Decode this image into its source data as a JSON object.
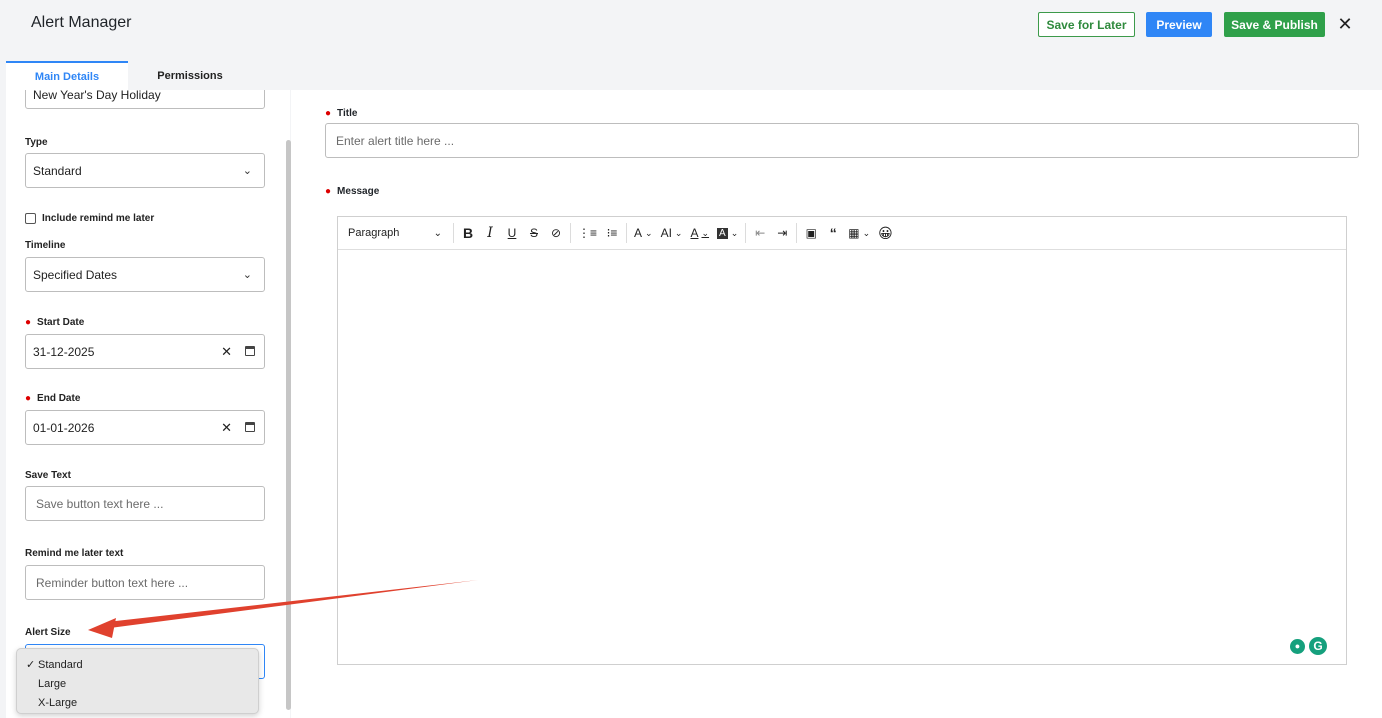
{
  "header": {
    "title": "Alert Manager",
    "save_later": "Save for Later",
    "preview": "Preview",
    "publish": "Save & Publish",
    "close": "✕"
  },
  "tabs": [
    "Main Details",
    "Permissions"
  ],
  "left": {
    "name_value": "New Year's Day Holiday",
    "type_label": "Type",
    "type_value": "Standard",
    "remind_checkbox_label": "Include remind me later",
    "timeline_label": "Timeline",
    "timeline_value": "Specified Dates",
    "start_label": "Start Date",
    "start_value": "31-12-2025",
    "end_label": "End Date",
    "end_value": "01-01-2026",
    "save_text_label": "Save Text",
    "save_text_placeholder": "Save button text here ...",
    "remind_text_label": "Remind me later text",
    "remind_text_placeholder": "Reminder button text here ...",
    "alert_size_label": "Alert Size",
    "alert_size_options": [
      "Standard",
      "Large",
      "X-Large"
    ],
    "alert_size_selected": "Standard"
  },
  "right": {
    "title_label": "Title",
    "title_placeholder": "Enter alert title here ...",
    "message_label": "Message",
    "toolbar": {
      "paragraph": "Paragraph",
      "icons": [
        "bold-icon",
        "italic-icon",
        "underline-icon",
        "strikethrough-icon",
        "link-icon",
        "numbered-list-icon",
        "bulleted-list-icon",
        "font-size-icon",
        "font-family-icon",
        "font-color-icon",
        "highlight-icon",
        "outdent-icon",
        "indent-icon",
        "image-icon",
        "blockquote-icon",
        "table-icon",
        "emoji-icon"
      ]
    }
  },
  "colors": {
    "accent_blue": "#2f86f6",
    "green": "#2fa04a",
    "required_red": "#d00000",
    "arrow_red": "#e0412e"
  }
}
